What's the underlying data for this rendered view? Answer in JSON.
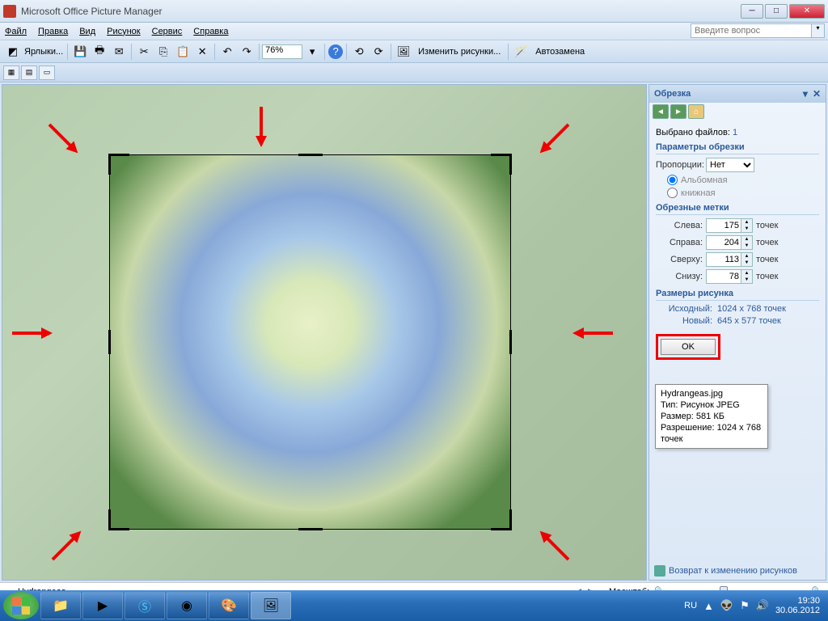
{
  "window": {
    "title": "Microsoft Office Picture Manager"
  },
  "menu": {
    "file": "Файл",
    "edit": "Правка",
    "view": "Вид",
    "picture": "Рисунок",
    "tools": "Сервис",
    "help": "Справка"
  },
  "helpbox": {
    "placeholder": "Введите вопрос"
  },
  "toolbar": {
    "shortcuts": "Ярлыки...",
    "zoom": "76%",
    "edit_pictures": "Изменить рисунки...",
    "autocorrect": "Автозамена"
  },
  "panel": {
    "title": "Обрезка",
    "files_selected_label": "Выбрано файлов:",
    "files_selected": "1",
    "crop_params": "Параметры обрезки",
    "aspect_label": "Пропорции:",
    "aspect_value": "Нет",
    "landscape": "Альбомная",
    "portrait": "книжная",
    "crop_marks": "Обрезные метки",
    "left_label": "Слева:",
    "left": "175",
    "right_label": "Справа:",
    "right": "204",
    "top_label": "Сверху:",
    "top": "113",
    "bottom_label": "Снизу:",
    "bottom": "78",
    "unit": "точек",
    "dims": "Размеры рисунка",
    "orig_label": "Исходный:",
    "orig": "1024 x 768 точек",
    "new_label": "Новый:",
    "new": "645 x 577 точек",
    "ok": "OK",
    "return": "Возврат к изменению рисунков"
  },
  "tooltip": {
    "name": "Hydrangeas.jpg",
    "type": "Тип: Рисунок JPEG",
    "size": "Размер: 581 КБ",
    "res": "Разрешение: 1024 x 768 точек"
  },
  "status": {
    "filename": "Hydrangeas",
    "zoom_label": "Масштаб:"
  },
  "tray": {
    "lang": "RU",
    "time": "19:30",
    "date": "30.06.2012"
  }
}
